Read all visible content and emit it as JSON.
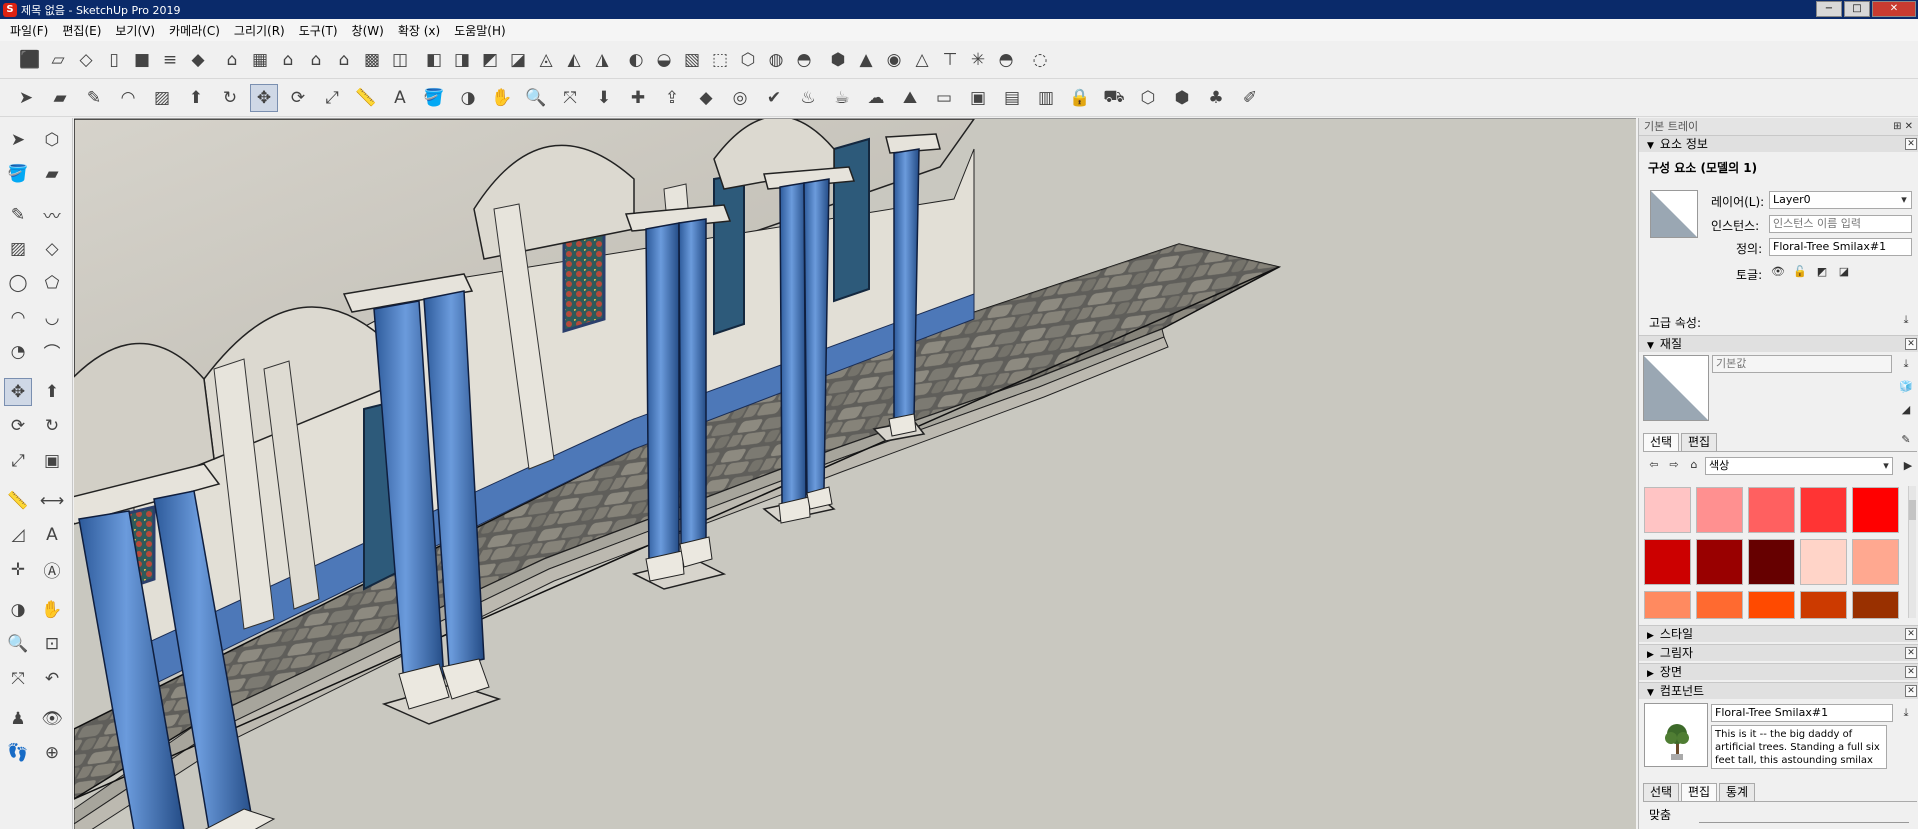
{
  "window": {
    "app_icon": "S",
    "title": "제목 없음 - SketchUp Pro 2019",
    "minimize": "−",
    "maximize": "□",
    "close": "✕"
  },
  "menus": [
    "파일(F)",
    "편집(E)",
    "보기(V)",
    "카메라(C)",
    "그리기(R)",
    "도구(T)",
    "창(W)",
    "확장 (x)",
    "도움말(H)"
  ],
  "toolbar_top": {
    "icons": [
      "box-icon",
      "sheet-icon",
      "cube-outline-icon",
      "page-icon",
      "solid-cube-icon",
      "stack-icon",
      "blue-cube-icon",
      "house-open-icon",
      "building-icon",
      "house-icon",
      "house-roof-icon",
      "house-outline-icon",
      "warehouse-icon",
      "layers-icon",
      "xray-icon",
      "back-edges-icon",
      "wireframe-icon",
      "hidden-line-icon",
      "shaded-icon",
      "shaded-texture-icon",
      "monochrome-icon",
      "shadow-icon",
      "fog-icon",
      "section-plane-icon",
      "wire-cube-icon",
      "iso-cube-icon",
      "checker-sphere-icon",
      "half-sphere-icon",
      "pointer-cube-icon",
      "sandbox-icon",
      "circle-hat-icon",
      "triangle-icon",
      "stick-icon",
      "burst-icon",
      "dome-icon",
      "disabled-dome-icon"
    ]
  },
  "toolbar_second": {
    "icons": [
      "select-icon",
      "eraser-icon",
      "pencil-icon",
      "arc-icon",
      "rectangle-icon",
      "push-pull-icon",
      "follow-me-icon",
      "move-icon",
      "rotate-icon",
      "scale-icon",
      "tape-measure-icon",
      "text-icon",
      "paint-bucket-icon",
      "orbit-icon",
      "pan-icon",
      "zoom-icon",
      "zoom-extents-icon",
      "warehouse-get-icon",
      "extension-icon",
      "share-icon",
      "ruby-icon",
      "profile-icon",
      "check-icon",
      "teapot-icon",
      "hand-teapot-icon",
      "cloud-icon",
      "terrain-icon",
      "flat-icon",
      "window-icon",
      "window2-icon",
      "window3-icon",
      "lock-icon",
      "section-car-icon",
      "box-open-icon",
      "box-open2-icon",
      "grass-icon",
      "pen-paper-icon"
    ]
  },
  "left_tools": [
    "select-icon",
    "component-icon",
    "paint-bucket-icon",
    "eraser-icon",
    "pencil-icon",
    "freehand-icon",
    "rectangle-icon",
    "rotated-rectangle-icon",
    "circle-icon",
    "polygon-icon",
    "arc-icon",
    "arc2-icon",
    "pie-icon",
    "arc3-icon",
    "move-icon",
    "push-pull-icon",
    "rotate-icon",
    "follow-me-icon",
    "scale-icon",
    "offset-icon",
    "tape-measure-icon",
    "dimension-icon",
    "protractor-icon",
    "text-icon",
    "axes-icon",
    "3d-text-icon",
    "orbit-icon",
    "pan-icon",
    "zoom-icon",
    "zoom-window-icon",
    "zoom-extents-icon",
    "previous-view-icon",
    "walk-icon",
    "look-around-icon",
    "footprints-icon",
    "section-icon"
  ],
  "tray": {
    "title": "기본 트레이",
    "pin": "⊞ ✕",
    "entity_info": {
      "header": "요소 정보",
      "heading": "구성 요소 (모델의 1)",
      "layer_label": "레이어(L):",
      "layer_value": "Layer0",
      "instance_label": "인스턴스:",
      "instance_placeholder": "인스턴스 이름 입력",
      "definition_label": "정의:",
      "definition_value": "Floral-Tree Smilax#1",
      "toggles_label": "토글:",
      "advanced_label": "고급 속성:"
    },
    "materials": {
      "header": "재질",
      "name_placeholder": "기본값",
      "tab_select": "선택",
      "tab_edit": "편집",
      "library": "색상",
      "swatches": [
        "#ffc4c4",
        "#ff9090",
        "#ff6060",
        "#ff3434",
        "#ff0000",
        "#cc0000",
        "#990000",
        "#660000",
        "#ffd4c8",
        "#ffa890",
        "#ff8a60",
        "#ff6a30",
        "#ff4a00",
        "#cc3a00",
        "#993000"
      ]
    },
    "collapsed": [
      "스타일",
      "그림자",
      "장면"
    ],
    "components": {
      "header": "컴포넌트",
      "name_value": "Floral-Tree Smilax#1",
      "description": "This is it -- the big daddy of artificial trees. Standing a full six feet tall, this astounding smilax silk tree will",
      "tab_select": "선택",
      "tab_edit": "편집",
      "tab_stats": "통계",
      "fit_label": "맞춤"
    }
  }
}
